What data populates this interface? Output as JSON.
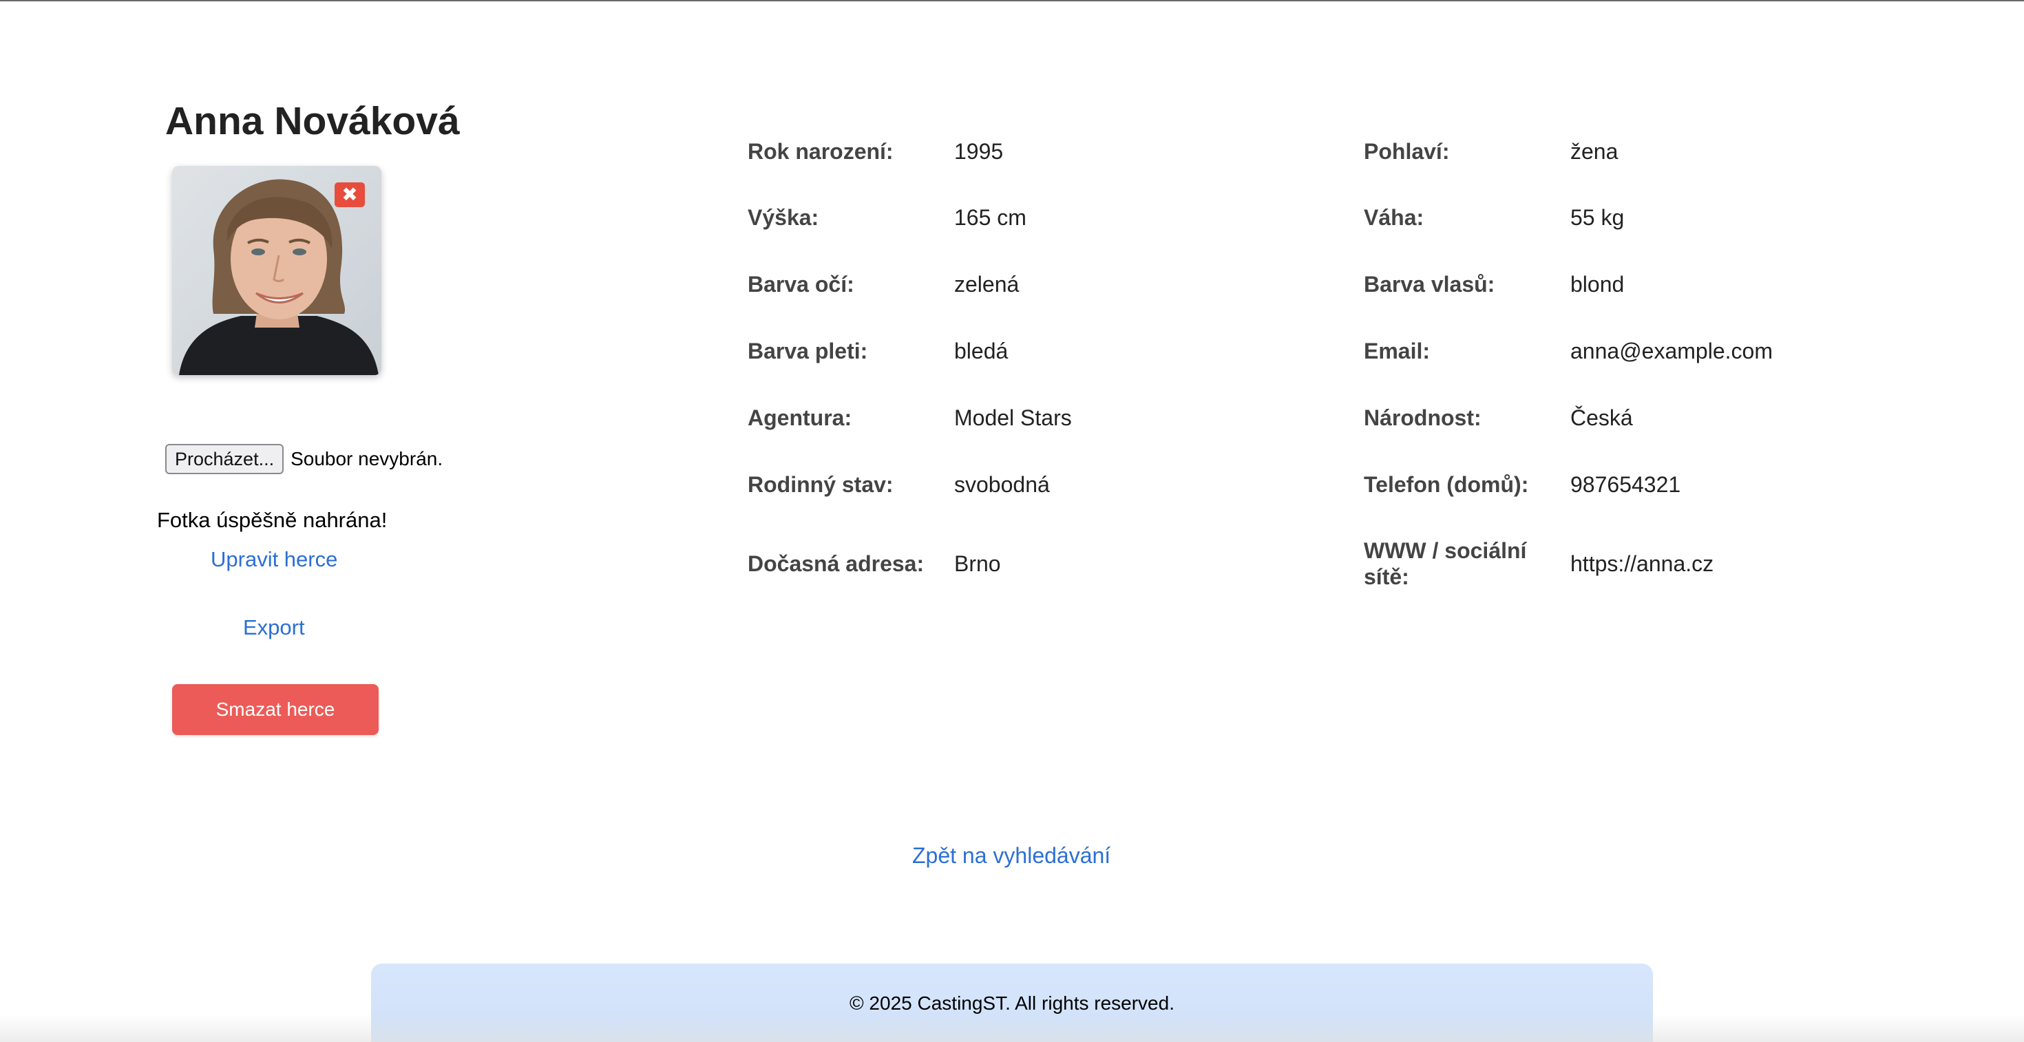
{
  "actor": {
    "name": "Anna Nováková"
  },
  "photo": {
    "delete_icon": "close-icon",
    "delete_symbol": "✖"
  },
  "upload": {
    "browse_label": "Procházet...",
    "file_status": "Soubor nevybrán.",
    "success_message": "Fotka úspěšně nahrána!"
  },
  "actions": {
    "edit_label": "Upravit herce",
    "export_label": "Export",
    "delete_label": "Smazat herce"
  },
  "details": {
    "left": [
      {
        "label": "Rok narození:",
        "value": "1995"
      },
      {
        "label": "Výška:",
        "value": "165 cm"
      },
      {
        "label": "Barva očí:",
        "value": "zelená"
      },
      {
        "label": "Barva pleti:",
        "value": "bledá"
      },
      {
        "label": "Agentura:",
        "value": "Model Stars"
      },
      {
        "label": "Rodinný stav:",
        "value": "svobodná"
      },
      {
        "label": "Dočasná adresa:",
        "value": "Brno"
      }
    ],
    "right": [
      {
        "label": "Pohlaví:",
        "value": "žena"
      },
      {
        "label": "Váha:",
        "value": "55 kg"
      },
      {
        "label": "Barva vlasů:",
        "value": "blond"
      },
      {
        "label": "Email:",
        "value": "anna@example.com"
      },
      {
        "label": "Národnost:",
        "value": "Česká"
      },
      {
        "label": "Telefon (domů):",
        "value": "987654321"
      },
      {
        "label": "WWW / sociální sítě:",
        "value": "https://anna.cz"
      }
    ]
  },
  "navigation": {
    "back_label": "Zpět na vyhledávání"
  },
  "footer": {
    "text": "© 2025 CastingST. All rights reserved."
  },
  "colors": {
    "link": "#2b6fd6",
    "danger": "#ec5b57",
    "footer_bg": "#d7e6fb"
  }
}
